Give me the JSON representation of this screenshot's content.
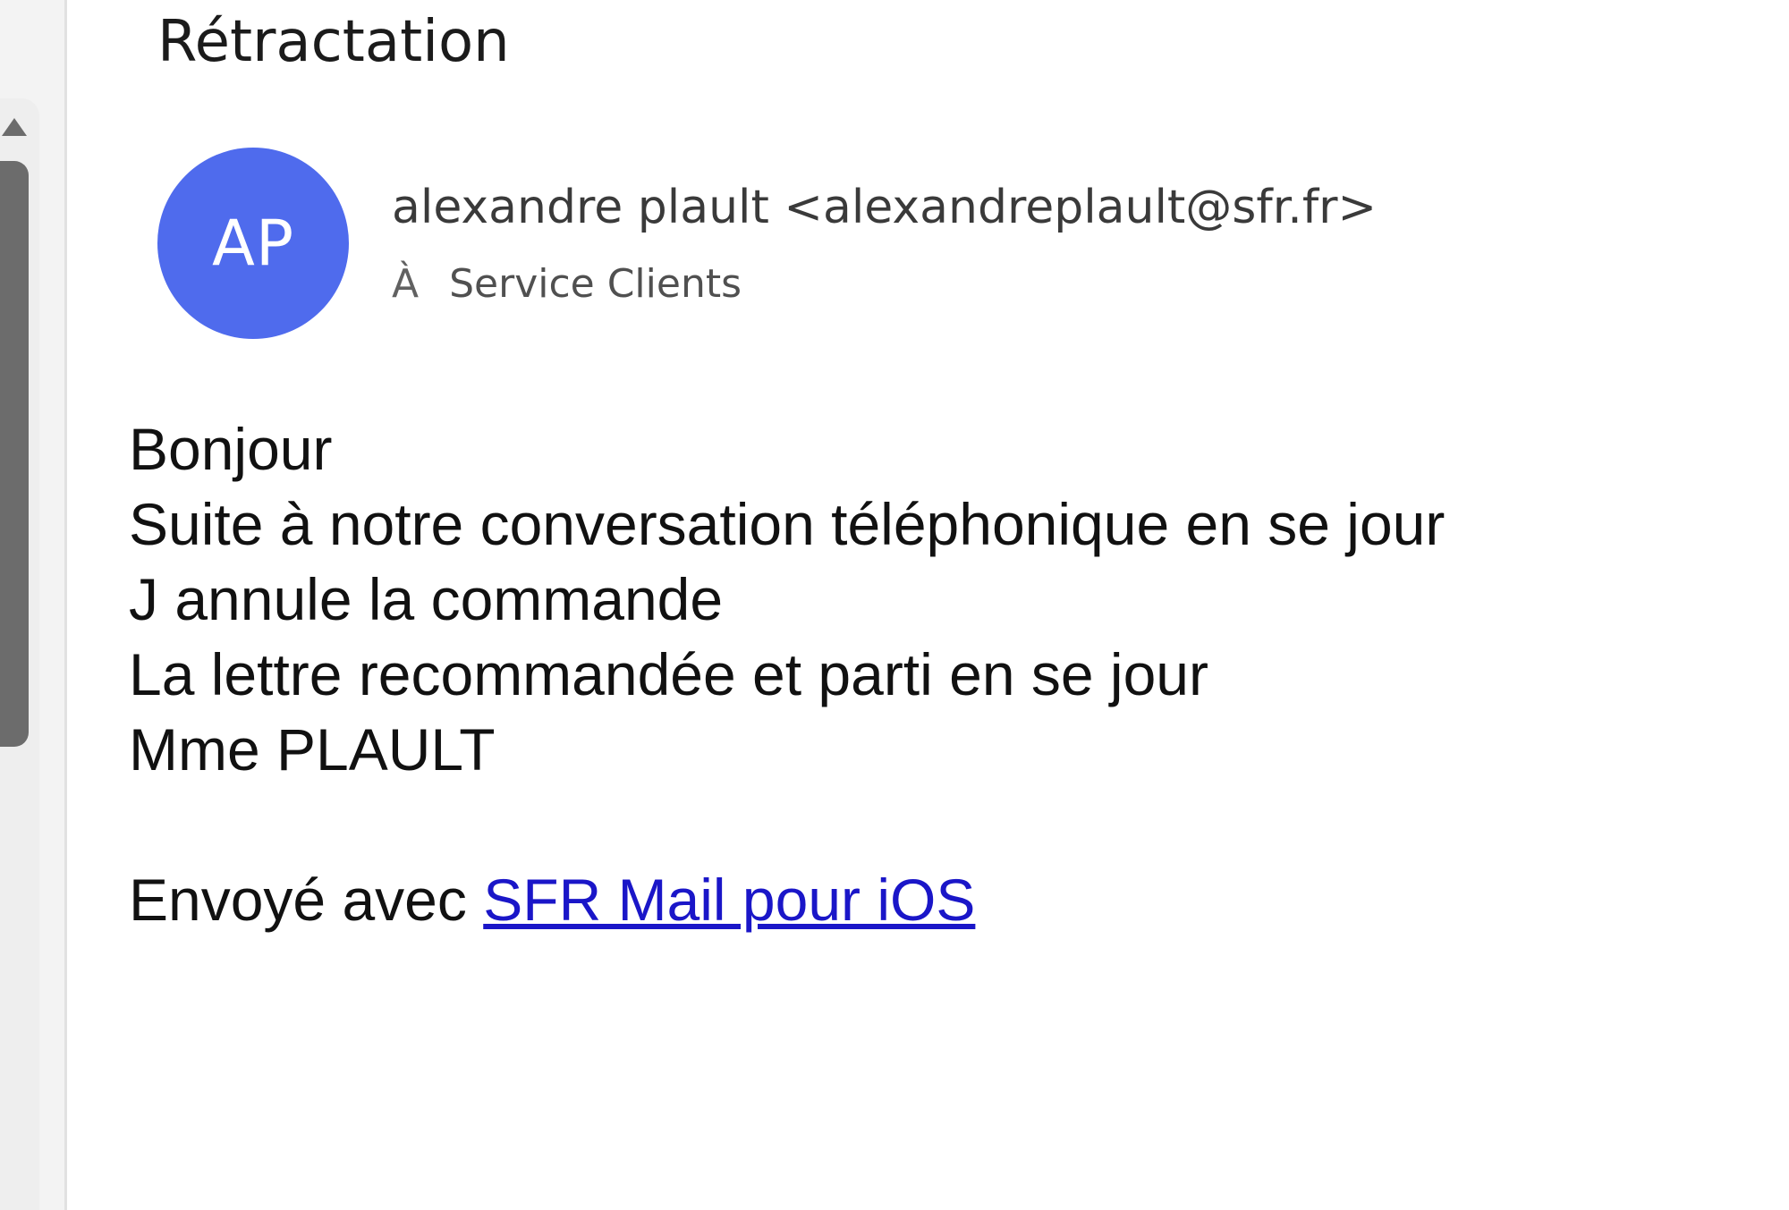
{
  "email": {
    "subject": "Rétractation",
    "avatar_initials": "AP",
    "avatar_color": "#4f6bed",
    "sender": "alexandre plault <alexandreplault@sfr.fr>",
    "to_label": "À",
    "recipient": "Service Clients",
    "body_lines": [
      "Bonjour",
      "Suite à notre conversation téléphonique en se jour",
      "J annule la commande",
      "La lettre recommandée et parti en se jour",
      "Mme PLAULT"
    ],
    "signature_prefix": "Envoyé avec ",
    "signature_link": "SFR Mail pour iOS",
    "link_color": "#1a16c8"
  },
  "icons": {
    "scroll_up": "chevron-up-icon"
  }
}
